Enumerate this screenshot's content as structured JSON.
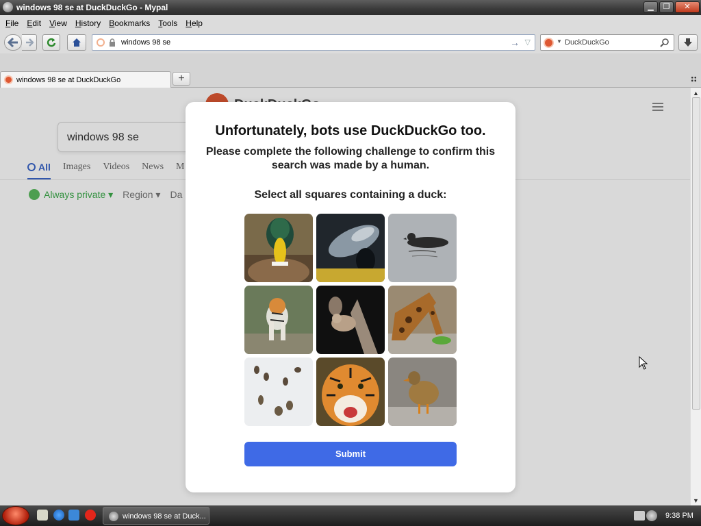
{
  "window": {
    "title": "windows 98 se at DuckDuckGo - Mypal",
    "buttons": [
      "minimize",
      "maximize",
      "close"
    ]
  },
  "menu": [
    "File",
    "Edit",
    "View",
    "History",
    "Bookmarks",
    "Tools",
    "Help"
  ],
  "toolbar": {
    "url": "windows 98 se",
    "search_placeholder": "DuckDuckGo"
  },
  "tabs": [
    {
      "title": "windows 98 se at DuckDuckGo"
    }
  ],
  "page": {
    "logo_text": "DuckDuckGo",
    "query": "windows 98 se",
    "tabs": [
      "All",
      "Images",
      "Videos",
      "News",
      "M"
    ],
    "filters": {
      "private": "Always private ▾",
      "region": "Region ▾",
      "date": "Da"
    }
  },
  "challenge": {
    "heading": "Unfortunately, bots use DuckDuckGo too.",
    "subheading": "Please complete the following challenge to confirm this search was made by a human.",
    "instruction": "Select all squares containing a duck:",
    "submit_label": "Submit",
    "tiles": [
      {
        "subject": "mallard duck head",
        "contains_duck": true
      },
      {
        "subject": "fish",
        "contains_duck": false
      },
      {
        "subject": "duck on water",
        "contains_duck": true
      },
      {
        "subject": "tiger",
        "contains_duck": false
      },
      {
        "subject": "squirrel",
        "contains_duck": false
      },
      {
        "subject": "giraffe",
        "contains_duck": false
      },
      {
        "subject": "ducks in snow",
        "contains_duck": true
      },
      {
        "subject": "tiger face",
        "contains_duck": false
      },
      {
        "subject": "standing duck",
        "contains_duck": true
      }
    ]
  },
  "taskbar": {
    "task_label": "windows 98 se at Duck...",
    "clock": "9:38 PM"
  },
  "colors": {
    "submit_blue": "#3f6ae6",
    "ddg_orange": "#de5833",
    "active_tab_blue": "#3a66c9"
  }
}
